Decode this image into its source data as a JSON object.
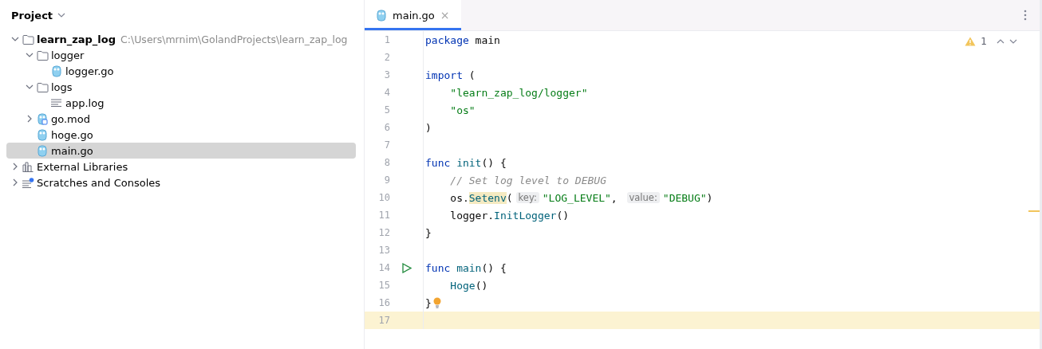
{
  "project_panel": {
    "title": "Project",
    "tree": [
      {
        "name": "learn_zap_log",
        "kind": "project",
        "path": "C:\\Users\\mrnim\\GolandProjects\\learn_zap_log",
        "expanded": true,
        "selected": false,
        "children": [
          {
            "name": "logger",
            "kind": "folder",
            "expanded": true,
            "selected": false,
            "children": [
              {
                "name": "logger.go",
                "kind": "go",
                "selected": false
              }
            ]
          },
          {
            "name": "logs",
            "kind": "folder",
            "expanded": true,
            "selected": false,
            "children": [
              {
                "name": "app.log",
                "kind": "log",
                "selected": false
              }
            ]
          },
          {
            "name": "go.mod",
            "kind": "gomod",
            "expanded": false,
            "selected": false
          },
          {
            "name": "hoge.go",
            "kind": "go",
            "selected": false
          },
          {
            "name": "main.go",
            "kind": "go",
            "selected": true
          }
        ]
      },
      {
        "name": "External Libraries",
        "kind": "libraries",
        "expanded": false,
        "selected": false
      },
      {
        "name": "Scratches and Consoles",
        "kind": "scratches",
        "expanded": false,
        "selected": false
      }
    ]
  },
  "editor": {
    "tabs": [
      {
        "label": "main.go",
        "close": "×",
        "selected": true
      }
    ],
    "inspections": {
      "warnings": "1"
    },
    "lines": [
      {
        "number": "1",
        "current": false,
        "tokens": [
          {
            "text": "package",
            "kind": "kw"
          },
          {
            "text": " main",
            "kind": "plain"
          }
        ]
      },
      {
        "number": "2",
        "current": false
      },
      {
        "number": "3",
        "current": false,
        "tokens": [
          {
            "text": "import",
            "kind": "kw"
          },
          {
            "text": " (",
            "kind": "plain"
          }
        ]
      },
      {
        "number": "4",
        "current": false,
        "tokens": [
          {
            "text": "    \"learn_zap_log/logger\"",
            "kind": "str"
          }
        ]
      },
      {
        "number": "5",
        "current": false,
        "tokens": [
          {
            "text": "    \"os\"",
            "kind": "str"
          }
        ]
      },
      {
        "number": "6",
        "current": false,
        "tokens": [
          {
            "text": ")",
            "kind": "plain"
          }
        ]
      },
      {
        "number": "7",
        "current": false
      },
      {
        "number": "8",
        "current": false,
        "tokens": [
          {
            "text": "func",
            "kind": "kw"
          },
          {
            "text": " init",
            "kind": "fn"
          },
          {
            "text": "() {",
            "kind": "plain"
          }
        ]
      },
      {
        "number": "9",
        "current": false,
        "tokens": [
          {
            "text": "    // Set log level to DEBUG",
            "kind": "comment"
          }
        ]
      },
      {
        "number": "10",
        "current": false,
        "tokens": [
          {
            "text": "    os.",
            "kind": "plain"
          },
          {
            "text": "Setenv",
            "kind": "call-highlighted"
          },
          {
            "text": "(",
            "kind": "plain"
          },
          {
            "text": "key:",
            "kind": "hint"
          },
          {
            "text": "\"LOG_LEVEL\"",
            "kind": "str"
          },
          {
            "text": ", ",
            "kind": "plain"
          },
          {
            "text": "value:",
            "kind": "hint"
          },
          {
            "text": "\"DEBUG\"",
            "kind": "str"
          },
          {
            "text": ")",
            "kind": "plain"
          }
        ]
      },
      {
        "number": "11",
        "current": false,
        "tokens": [
          {
            "text": "    logger.",
            "kind": "plain"
          },
          {
            "text": "InitLogger",
            "kind": "call"
          },
          {
            "text": "()",
            "kind": "plain"
          }
        ]
      },
      {
        "number": "12",
        "current": false,
        "tokens": [
          {
            "text": "}",
            "kind": "plain"
          }
        ]
      },
      {
        "number": "13",
        "current": false
      },
      {
        "number": "14",
        "current": false,
        "kind": "run",
        "tokens": [
          {
            "text": "func",
            "kind": "kw"
          },
          {
            "text": " main",
            "kind": "fn"
          },
          {
            "text": "() {",
            "kind": "plain"
          }
        ]
      },
      {
        "number": "15",
        "current": false,
        "tokens": [
          {
            "text": "    Hoge",
            "kind": "call"
          },
          {
            "text": "()",
            "kind": "plain"
          }
        ]
      },
      {
        "number": "16",
        "current": false,
        "kind": "bulb",
        "tokens": [
          {
            "text": "}",
            "kind": "plain"
          }
        ]
      },
      {
        "number": "17",
        "current": true
      }
    ]
  }
}
